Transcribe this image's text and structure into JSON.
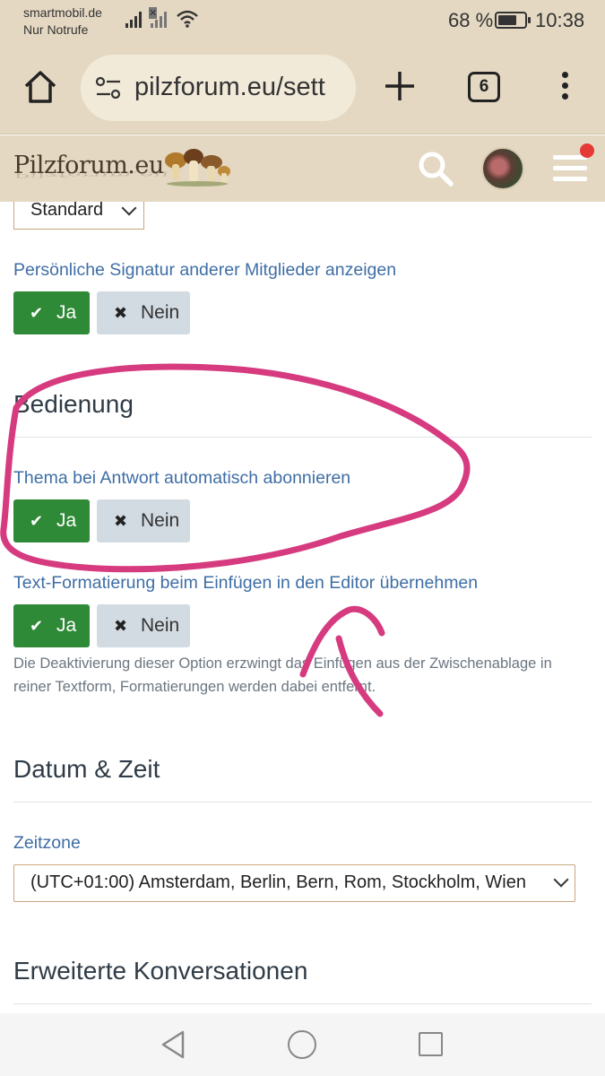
{
  "status_bar": {
    "carrier_line1": "smartmobil.de",
    "carrier_line2": "Nur Notrufe",
    "battery_percent": "68 %",
    "battery_level": 0.68,
    "time": "10:38"
  },
  "browser": {
    "url": "pilzforum.eu/sett",
    "tab_count": "6",
    "icons": [
      "home-icon",
      "site-settings-icon",
      "plus-icon",
      "tabs-icon",
      "more-icon"
    ]
  },
  "site_header": {
    "logo_text": "Pilzforum.eu",
    "icons": [
      "search-icon",
      "avatar",
      "hamburger-icon"
    ],
    "notification_color": "#e53935"
  },
  "settings": {
    "style_select_value": "Standard",
    "signature": {
      "label": "Persönliche Signatur anderer Mitglieder anzeigen",
      "yes": "Ja",
      "no": "Nein"
    },
    "section_bedienung": "Bedienung",
    "auto_subscribe": {
      "label": "Thema bei Antwort automatisch abonnieren",
      "yes": "Ja",
      "no": "Nein"
    },
    "paste_formatting": {
      "label": "Text-Formatierung beim Einfügen in den Editor übernehmen",
      "yes": "Ja",
      "no": "Nein",
      "hint": "Die Deaktivierung dieser Option erzwingt das Einfügen aus der Zwischenablage in reiner Textform, Formatierungen werden dabei entfernt."
    },
    "section_datetime": "Datum & Zeit",
    "timezone": {
      "label": "Zeitzone",
      "value": "(UTC+01:00) Amsterdam, Berlin, Bern, Rom, Stockholm, Wien"
    },
    "section_conversations": "Erweiterte Konversationen"
  },
  "colors": {
    "accent_green": "#2e8a37",
    "label_blue": "#3f6ea5",
    "header_beige": "#e4d8c2",
    "annotation_pink": "#d63a7f"
  }
}
